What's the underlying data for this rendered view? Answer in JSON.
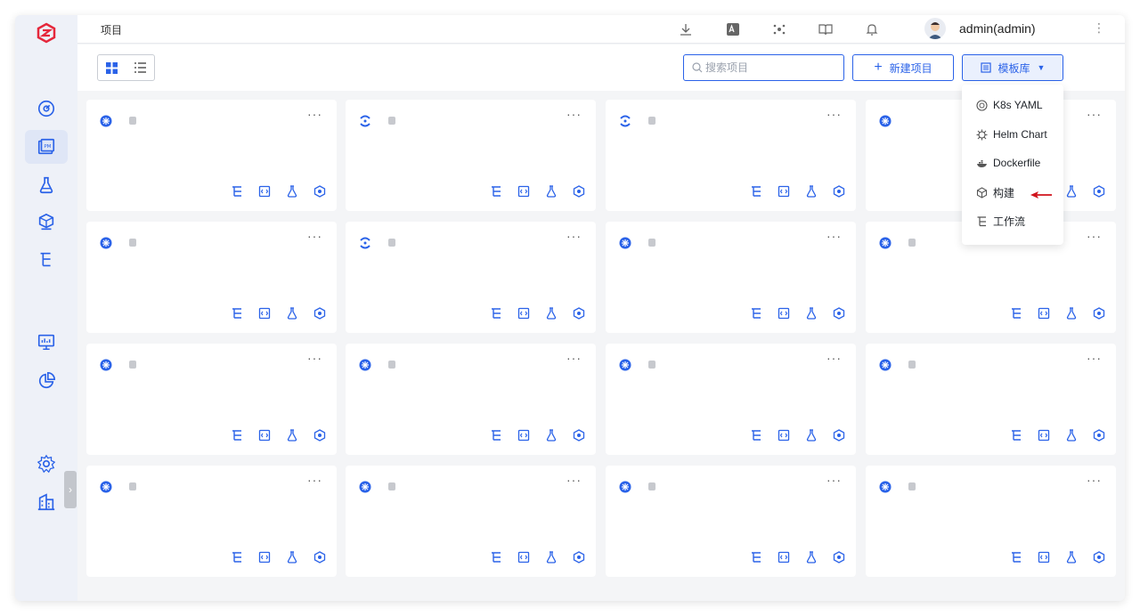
{
  "breadcrumb": "项目",
  "user": {
    "name": "admin(admin)"
  },
  "toolbar": {
    "search_placeholder": "搜索项目",
    "new_project_label": "新建项目",
    "templates_label": "模板库"
  },
  "template_menu": {
    "items": [
      {
        "label": "K8s YAML",
        "icon": "kubernetes-icon"
      },
      {
        "label": "Helm Chart",
        "icon": "helm-icon"
      },
      {
        "label": "Dockerfile",
        "icon": "docker-icon"
      },
      {
        "label": "构建",
        "icon": "build-cube-icon"
      },
      {
        "label": "工作流",
        "icon": "workflow-icon"
      }
    ]
  },
  "projects": [
    {
      "name": "",
      "desc": "",
      "icon": "k8s"
    },
    {
      "name": "",
      "desc": "",
      "icon": "helm"
    },
    {
      "name": "",
      "desc": "",
      "icon": "helm"
    },
    {
      "name": "",
      "desc": "",
      "icon": "k8s"
    },
    {
      "name": "",
      "desc": "",
      "icon": "k8s"
    },
    {
      "name": "",
      "desc": "",
      "icon": "helm"
    },
    {
      "name": "",
      "desc": "",
      "icon": "k8s"
    },
    {
      "name": "",
      "desc": "",
      "icon": "k8s"
    },
    {
      "name": "",
      "desc": "",
      "icon": "k8s"
    },
    {
      "name": "",
      "desc": "",
      "icon": "k8s"
    },
    {
      "name": "",
      "desc": "",
      "icon": "k8s"
    },
    {
      "name": "",
      "desc": "",
      "icon": "k8s"
    },
    {
      "name": "",
      "desc": "",
      "icon": "k8s"
    },
    {
      "name": "",
      "desc": "",
      "icon": "k8s"
    },
    {
      "name": "",
      "desc": "",
      "icon": "k8s"
    },
    {
      "name": "",
      "desc": "",
      "icon": "k8s"
    }
  ],
  "colors": {
    "accent": "#2a62e8",
    "logo": "#e5273b",
    "arrow": "#d0121b"
  }
}
